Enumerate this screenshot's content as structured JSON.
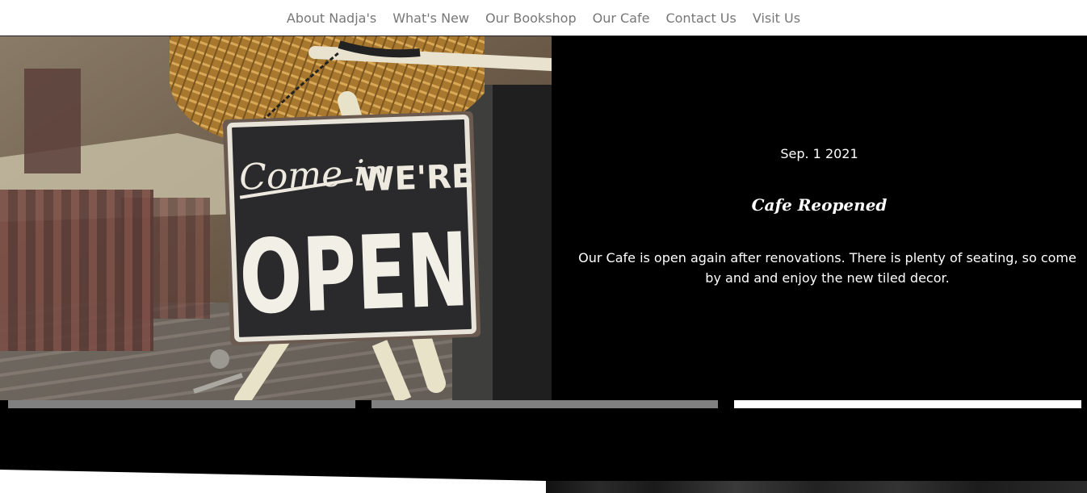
{
  "nav": {
    "items": [
      {
        "label": "About Nadja's"
      },
      {
        "label": "What's New"
      },
      {
        "label": "Our Bookshop"
      },
      {
        "label": "Our Cafe"
      },
      {
        "label": "Contact Us"
      },
      {
        "label": "Visit Us"
      }
    ],
    "text_color": "#777777"
  },
  "slide": {
    "image": {
      "sign_script": "Come in",
      "sign_small": "WE'RE",
      "sign_big": "OPEN"
    },
    "date": "Sep. 1 2021",
    "title": "Cafe Reopened",
    "body": "Our Cafe is open again after renovations. There is plenty of seating, so come by and and enjoy the new tiled decor."
  },
  "carousel": {
    "indicators": [
      {
        "active": false,
        "color": "#808080"
      },
      {
        "active": false,
        "color": "#808080"
      },
      {
        "active": true,
        "color": "#ffffff"
      }
    ]
  },
  "colors": {
    "background": "#000000",
    "nav_background": "#ffffff",
    "text_light": "#ffffff"
  }
}
